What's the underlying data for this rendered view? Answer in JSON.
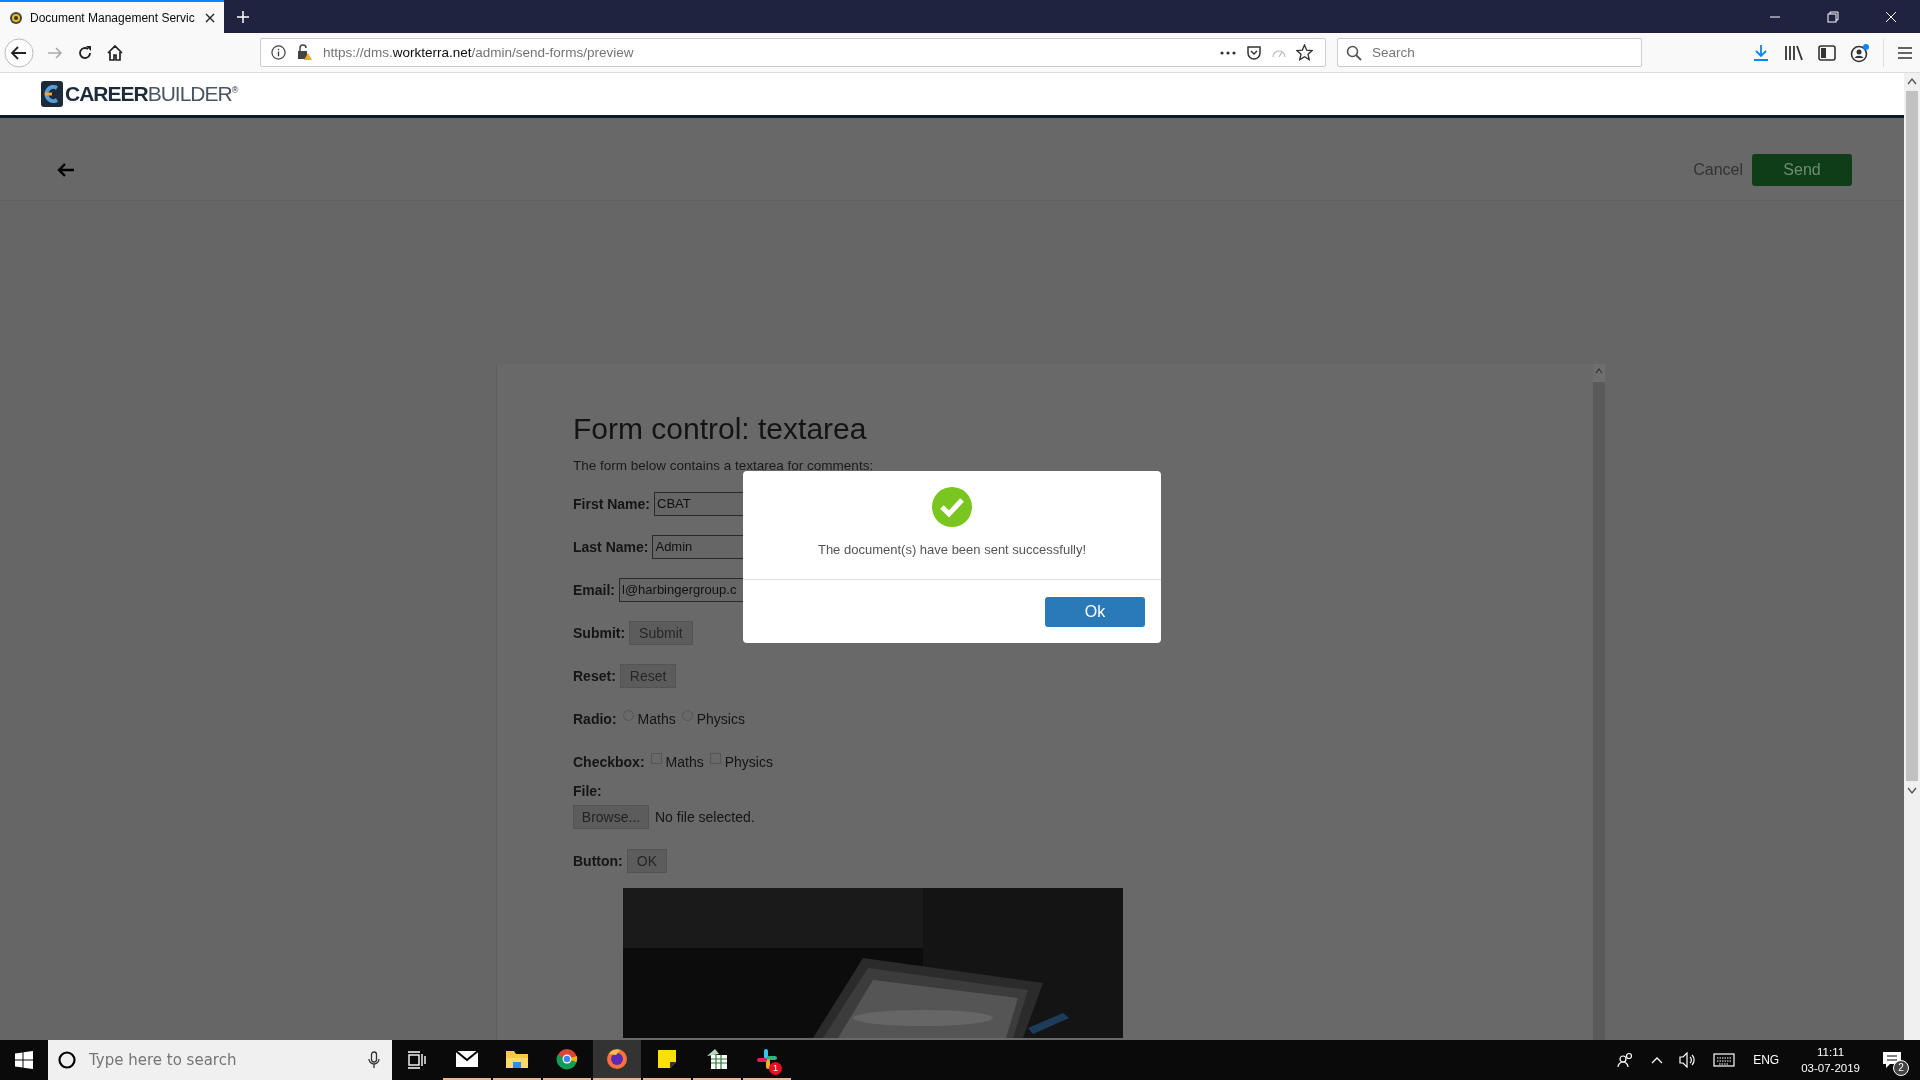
{
  "browser": {
    "tabs": [
      {
        "title": "Document Management Servic",
        "selected": true
      }
    ],
    "url": {
      "start": "https://dms.",
      "domain": "workterra.net",
      "path": "/admin/send-forms/preview"
    },
    "search": {
      "placeholder": "Search"
    }
  },
  "app": {
    "logo": {
      "bold": "CAREER",
      "light": "BUILDER",
      "mark": "®"
    },
    "cancel": "Cancel",
    "send": "Send"
  },
  "document": {
    "title": "Form control: textarea",
    "intro": "The form below contains a textarea for comments:",
    "rows": [
      {
        "kind": "input",
        "label": "First Name:",
        "value": "CBAT"
      },
      {
        "kind": "input",
        "label": "Last Name:",
        "value": "Admin"
      },
      {
        "kind": "input",
        "label": "Email:",
        "value": "l@harbingergroup.c"
      },
      {
        "kind": "button",
        "label": "Submit:",
        "button": "Submit"
      },
      {
        "kind": "button",
        "label": "Reset:",
        "button": "Reset"
      },
      {
        "kind": "radio",
        "label": "Radio:",
        "options": [
          {
            "label": "Maths",
            "selected": false
          },
          {
            "label": "Physics",
            "selected": false
          }
        ]
      },
      {
        "kind": "checkbox",
        "label": "Checkbox:",
        "options": [
          {
            "label": "Maths",
            "checked": false
          },
          {
            "label": "Physics",
            "checked": false
          }
        ]
      },
      {
        "kind": "file",
        "label": "File:",
        "button": "Browse...",
        "status": "No file selected."
      },
      {
        "kind": "button",
        "label": "Button:",
        "button": "OK"
      }
    ]
  },
  "dialog": {
    "message": "The document(s) have been sent successfully!",
    "ok": "Ok"
  },
  "taskbar": {
    "search_placeholder": "Type here to search",
    "apps": [
      {
        "selected": false
      },
      {
        "selected": false
      },
      {
        "selected": false
      },
      {
        "selected": true
      },
      {
        "selected": false
      },
      {
        "selected": false
      },
      {
        "selected": false,
        "badge": "1"
      }
    ],
    "language": "ENG",
    "time": "11:11",
    "date": "03-07-2019",
    "notifications": "2"
  }
}
